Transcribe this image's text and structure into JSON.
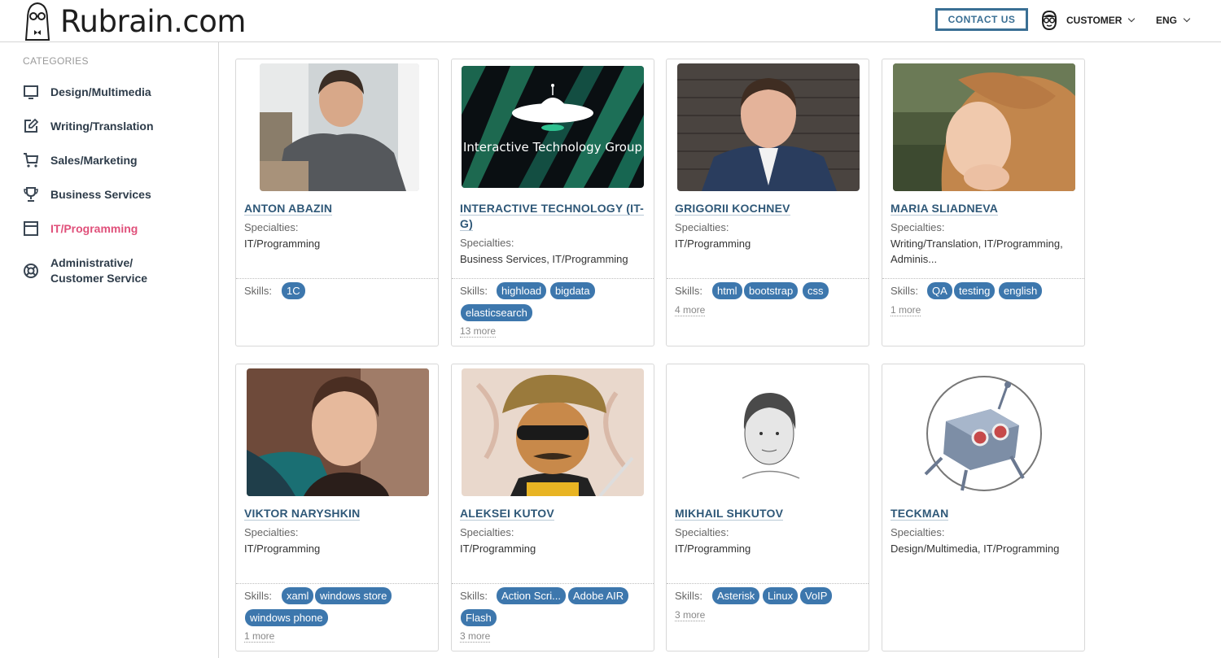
{
  "header": {
    "logo_text": "Rubrain.com",
    "contact_label": "CONTACT US",
    "customer_label": "CUSTOMER",
    "lang_label": "ENG"
  },
  "sidebar": {
    "title": "CATEGORIES",
    "items": [
      {
        "label": "Design/Multimedia",
        "icon": "monitor-icon",
        "active": false
      },
      {
        "label": "Writing/Translation",
        "icon": "edit-icon",
        "active": false
      },
      {
        "label": "Sales/Marketing",
        "icon": "cart-icon",
        "active": false
      },
      {
        "label": "Business Services",
        "icon": "trophy-icon",
        "active": false
      },
      {
        "label": "IT/Programming",
        "icon": "window-icon",
        "active": true
      },
      {
        "label": "Administrative/ Customer Service",
        "icon": "lifebuoy-icon",
        "active": false
      }
    ]
  },
  "cards": [
    {
      "name": "ANTON ABAZIN",
      "specialties_label": "Specialties:",
      "specialties": "IT/Programming",
      "skills_label": "Skills:",
      "skills": [
        "1C"
      ],
      "more": "",
      "image": "photo-man-office"
    },
    {
      "name": "INTERACTIVE TECHNOLOGY (IT-G)",
      "specialties_label": "Specialties:",
      "specialties": "Business Services, IT/Programming",
      "skills_label": "Skills:",
      "skills": [
        "highload",
        "bigdata",
        "elasticsearch"
      ],
      "more": "13 more",
      "image": "logo-itg",
      "image_text": "Interactive Technology Group"
    },
    {
      "name": "GRIGORII KOCHNEV",
      "specialties_label": "Specialties:",
      "specialties": "IT/Programming",
      "skills_label": "Skills:",
      "skills": [
        "html",
        "bootstrap",
        "css"
      ],
      "more": "4 more",
      "image": "photo-man-brick"
    },
    {
      "name": "MARIA SLIADNEVA",
      "specialties_label": "Specialties:",
      "specialties": "Writing/Translation, IT/Programming, Adminis...",
      "skills_label": "Skills:",
      "skills": [
        "QA",
        "testing",
        "english"
      ],
      "more": "1 more",
      "image": "photo-woman"
    },
    {
      "name": "VIKTOR NARYSHKIN",
      "specialties_label": "Specialties:",
      "specialties": "IT/Programming",
      "skills_label": "Skills:",
      "skills": [
        "xaml",
        "windows store",
        "windows phone"
      ],
      "more": "1 more",
      "image": "photo-man-scarf"
    },
    {
      "name": "ALEKSEI KUTOV",
      "specialties_label": "Specialties:",
      "specialties": "IT/Programming",
      "skills_label": "Skills:",
      "skills": [
        "Action Scri...",
        "Adobe AIR",
        "Flash"
      ],
      "more": "3 more",
      "image": "cartoon-character"
    },
    {
      "name": "MIKHAIL SHKUTOV",
      "specialties_label": "Specialties:",
      "specialties": "IT/Programming",
      "skills_label": "Skills:",
      "skills": [
        "Asterisk",
        "Linux",
        "VoIP"
      ],
      "more": "3 more",
      "image": "sketch-portrait"
    },
    {
      "name": "TECKMAN",
      "specialties_label": "Specialties:",
      "specialties": "Design/Multimedia, IT/Programming",
      "skills_label": "",
      "skills": [],
      "more": "",
      "image": "robot-logo"
    }
  ],
  "colors": {
    "accent": "#3d77ad",
    "active_category": "#e0507a",
    "name": "#2f5878",
    "contact_border": "#3a6f94"
  }
}
